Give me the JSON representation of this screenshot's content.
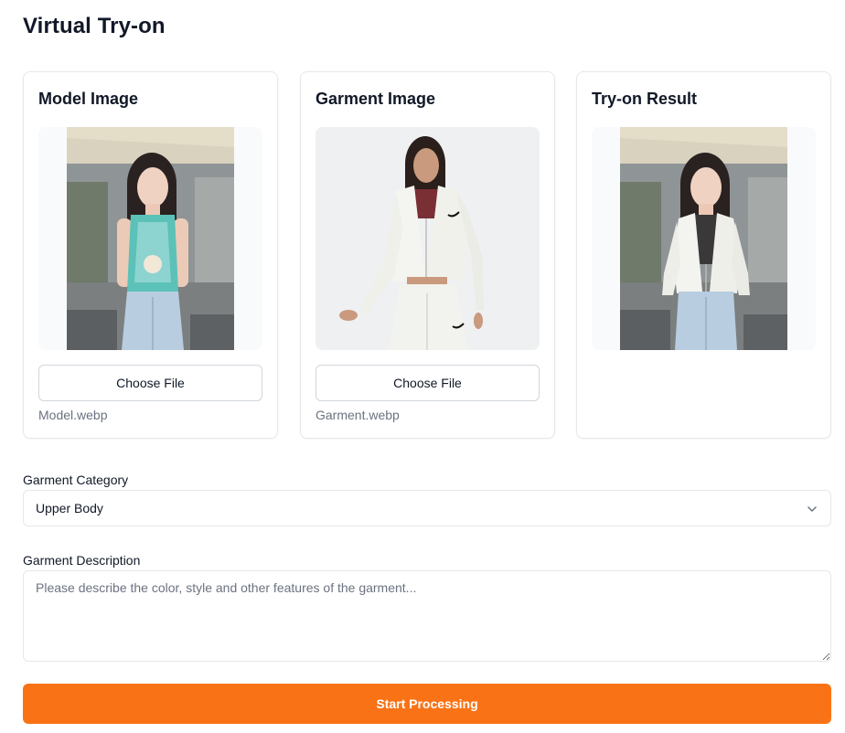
{
  "page": {
    "title": "Virtual Try-on"
  },
  "cards": {
    "model": {
      "title": "Model Image",
      "button_label": "Choose File",
      "file_name": "Model.webp",
      "image": "model-photo"
    },
    "garment": {
      "title": "Garment Image",
      "button_label": "Choose File",
      "file_name": "Garment.webp",
      "image": "garment-photo"
    },
    "result": {
      "title": "Try-on Result",
      "image": "tryon-result-photo"
    }
  },
  "category": {
    "label": "Garment Category",
    "selected": "Upper Body",
    "icon": "chevron-down-icon"
  },
  "description": {
    "label": "Garment Description",
    "value": "",
    "placeholder": "Please describe the color, style and other features of the garment..."
  },
  "actions": {
    "start_label": "Start Processing"
  },
  "colors": {
    "accent": "#f97316",
    "border": "#e5e7eb",
    "muted_text": "#6b7280"
  }
}
